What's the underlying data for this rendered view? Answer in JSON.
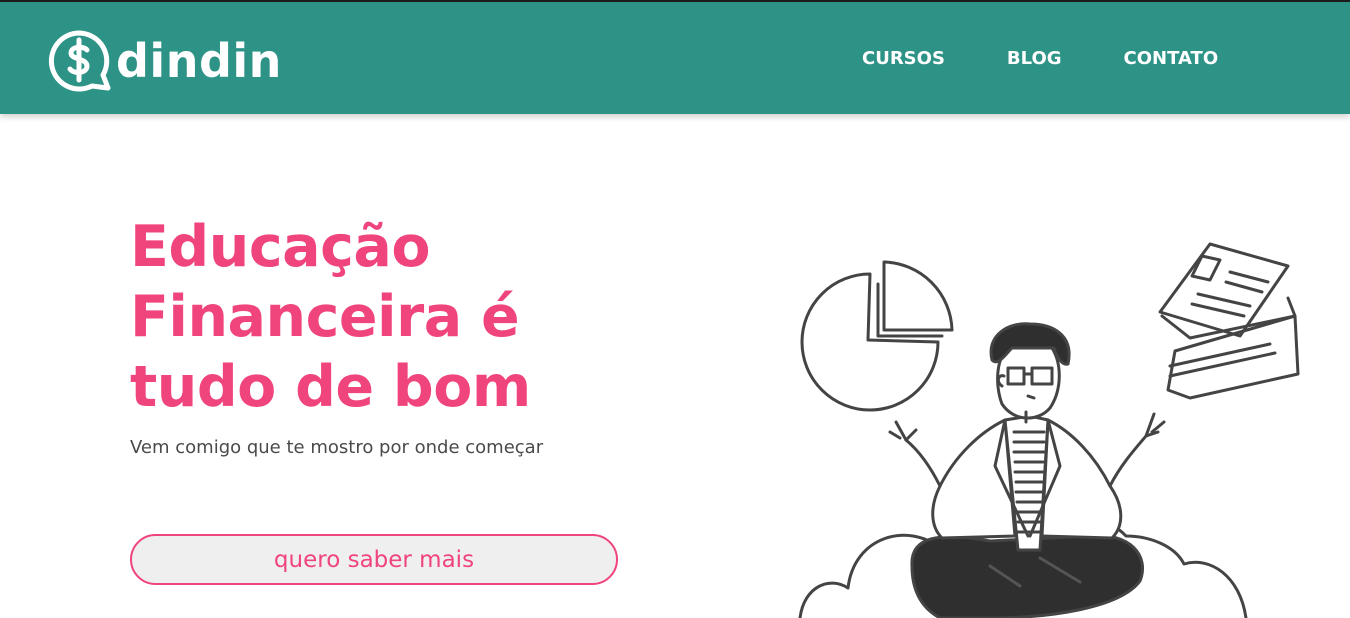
{
  "header": {
    "logo_text": "dindin",
    "logo_icon": "dollar-speech-bubble-icon",
    "nav": [
      {
        "label": "CURSOS"
      },
      {
        "label": "BLOG"
      },
      {
        "label": "CONTATO"
      }
    ]
  },
  "hero": {
    "title_lines": [
      "Educação",
      "Financeira é",
      "tudo de bom"
    ],
    "subtitle": "Vem comigo que te mostro por onde começar",
    "cta_label": "quero saber mais"
  },
  "colors": {
    "header_bg": "#2e9387",
    "accent": "#f0447d",
    "text": "#4a4a4a",
    "button_bg": "#efefef"
  }
}
